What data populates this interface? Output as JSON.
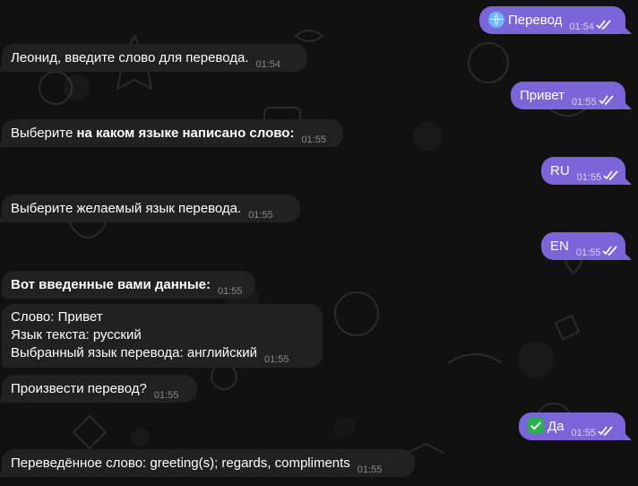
{
  "messages": {
    "m1": {
      "text": "Перевод",
      "time": "01:54",
      "emoji": "globe-icon"
    },
    "m2": {
      "text": "Леонид, введите слово для перевода.",
      "time": "01:54"
    },
    "m3": {
      "text": "Привет",
      "time": "01:55"
    },
    "m4": {
      "prefix": "Выберите ",
      "bold": "на каком языке написано слово:",
      "time": "01:55"
    },
    "m5": {
      "text": "RU",
      "time": "01:55"
    },
    "m6": {
      "text": "Выберите желаемый язык перевода.",
      "time": "01:55"
    },
    "m7": {
      "text": "EN",
      "time": "01:55"
    },
    "m8": {
      "text": "Вот введенные вами данные:",
      "time": "01:55"
    },
    "m9": {
      "line1": "Слово: Привет",
      "line2": "Язык текста: русский",
      "line3": "Выбранный язык перевода: английский",
      "time": "01:55"
    },
    "m10": {
      "text": "Произвести перевод?",
      "time": "01:55"
    },
    "m11": {
      "text": "Да",
      "time": "01:55",
      "emoji": "check-box-icon"
    },
    "m12": {
      "text": "Переведённое слово: greeting(s); regards, compliments",
      "time": "01:55"
    }
  },
  "colors": {
    "background": "#111111",
    "incoming_bubble": "#212121",
    "outgoing_bubble": "#7a66d8",
    "accent_check": "#27b24a"
  }
}
